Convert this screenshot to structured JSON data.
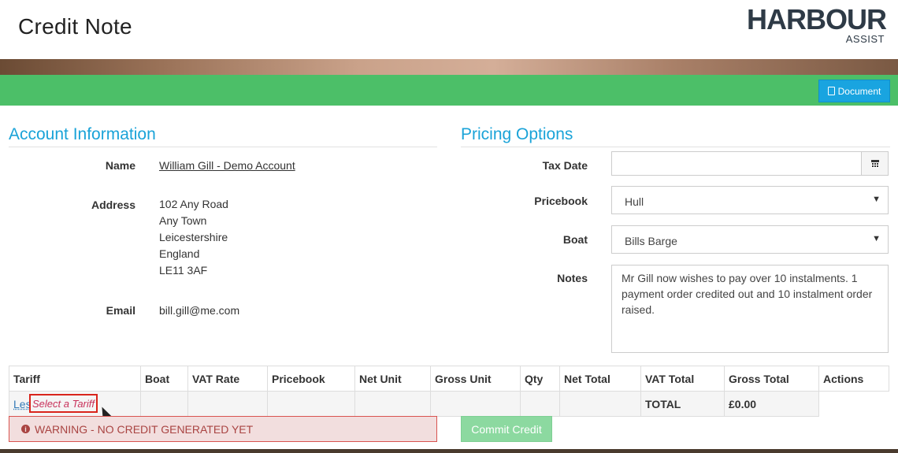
{
  "page": {
    "title": "Credit Note"
  },
  "logo": {
    "main": "HARBOUR",
    "sub": "ASSIST"
  },
  "toolbar": {
    "document_label": "Document"
  },
  "account": {
    "heading": "Account Information",
    "name_label": "Name",
    "name_value": "William Gill - Demo Account",
    "address_label": "Address",
    "address_lines": [
      "102 Any Road",
      "Any Town",
      "Leicestershire",
      "England",
      "LE11 3AF"
    ],
    "email_label": "Email",
    "email_value": "bill.gill@me.com"
  },
  "pricing": {
    "heading": "Pricing Options",
    "tax_date_label": "Tax Date",
    "tax_date_value": "",
    "pricebook_label": "Pricebook",
    "pricebook_value": "Hull",
    "boat_label": "Boat",
    "boat_value": "Bills Barge",
    "notes_label": "Notes",
    "notes_value": "Mr Gill now wishes to pay over 10 instalments.  1 payment order credited out and 10 instalment order raised."
  },
  "table": {
    "headers": [
      "Tariff",
      "Boat",
      "VAT Rate",
      "Pricebook",
      "Net Unit",
      "Gross Unit",
      "Qty",
      "Net Total",
      "VAT Total",
      "Gross Total",
      "Actions"
    ],
    "row_tariff_prefix": "Les",
    "row_tariff_select": "Select a Tariff",
    "total_label": "TOTAL",
    "total_value": "£0.00"
  },
  "status": {
    "warning": "WARNING - NO CREDIT GENERATED YET"
  },
  "actions": {
    "commit_label": "Commit Credit"
  },
  "colors": {
    "accent": "#1aa3d8",
    "green_bar": "#4cbf68",
    "warning_bg": "#f2dede",
    "warning_text": "#a94442"
  }
}
